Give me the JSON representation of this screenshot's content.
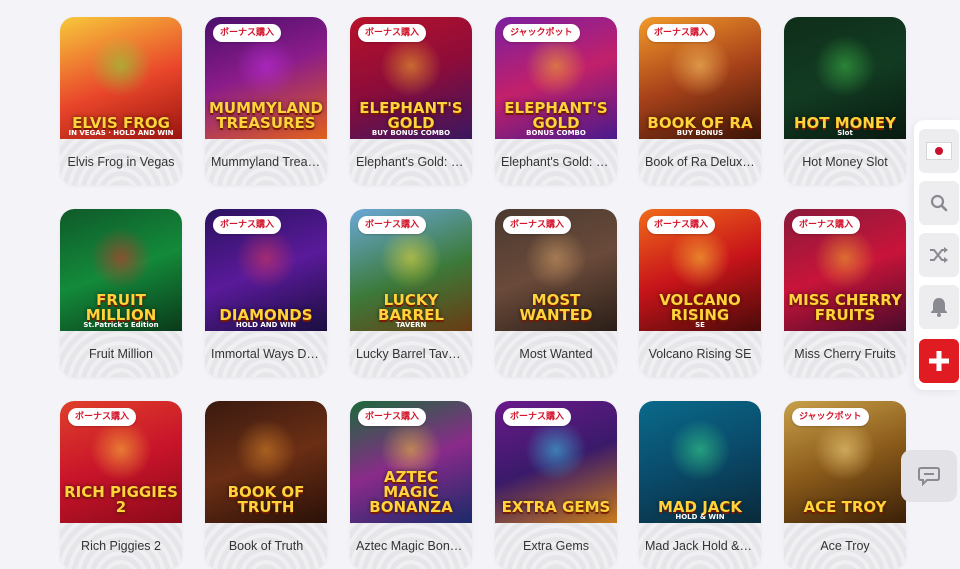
{
  "cards": [
    {
      "name": "Elvis Frog in Vegas",
      "badge": "",
      "art_title": "ELVIS FROG",
      "art_sub": "IN VEGAS · HOLD AND WIN",
      "bg": "linear-gradient(160deg,#f7c93b 0%,#e9462a 55%,#9b1410 100%)",
      "glow": "#7fe03a"
    },
    {
      "name": "Mummyland Treasures",
      "badge": "ボーナス購入",
      "art_title": "MUMMYLAND TREASURES",
      "art_sub": "",
      "bg": "linear-gradient(160deg,#4a0f6b 0%,#8b1c8a 45%,#e0611b 100%)",
      "glow": "#c030e0"
    },
    {
      "name": "Elephant's Gold: Buy Bonus Combo",
      "badge": "ボーナス購入",
      "art_title": "ELEPHANT'S GOLD",
      "art_sub": "BUY BONUS COMBO",
      "bg": "linear-gradient(160deg,#b8122a 0%,#8c0c3a 50%,#3a1760 100%)",
      "glow": "#f5b52a"
    },
    {
      "name": "Elephant's Gold: Bonus Combo",
      "badge": "ジャックポット",
      "art_title": "ELEPHANT'S GOLD",
      "art_sub": "BONUS COMBO",
      "bg": "linear-gradient(160deg,#7a1fa0 0%,#c2206a 50%,#4a1a8c 100%)",
      "glow": "#f5b52a"
    },
    {
      "name": "Book of Ra Deluxe Buy Bonus",
      "badge": "ボーナス購入",
      "art_title": "BOOK OF RA",
      "art_sub": "BUY BONUS",
      "bg": "linear-gradient(160deg,#f29a2a 0%,#a8421a 50%,#3b1408 100%)",
      "glow": "#ffd06a"
    },
    {
      "name": "Hot Money Slot",
      "badge": "",
      "art_title": "HOT MONEY",
      "art_sub": "Slot",
      "bg": "linear-gradient(160deg,#0f2e1a 0%,#123b22 50%,#081a10 100%)",
      "glow": "#3fbf4a"
    },
    {
      "name": "Fruit Million",
      "badge": "",
      "art_title": "FRUIT MILLION",
      "art_sub": "St.Patrick's Edition",
      "bg": "linear-gradient(160deg,#0f5a2a 0%,#138a3a 50%,#0a3a1a 100%)",
      "glow": "#e52a2a"
    },
    {
      "name": "Immortal Ways Diamonds",
      "badge": "ボーナス購入",
      "art_title": "DIAMONDS",
      "art_sub": "HOLD AND WIN",
      "bg": "linear-gradient(160deg,#2a1260 0%,#5a1a9a 50%,#1a0e40 100%)",
      "glow": "#e33a5a"
    },
    {
      "name": "Lucky Barrel Tavern",
      "badge": "ボーナス購入",
      "art_title": "LUCKY BARREL",
      "art_sub": "TAVERN",
      "bg": "linear-gradient(160deg,#6aa8d8 0%,#3c7a3a 55%,#6a3a12 100%)",
      "glow": "#f5e03a"
    },
    {
      "name": "Most Wanted",
      "badge": "ボーナス購入",
      "art_title": "MOST WANTED",
      "art_sub": "",
      "bg": "linear-gradient(160deg,#4a3a30 0%,#6a4a3a 50%,#2a1e18 100%)",
      "glow": "#d8a46a"
    },
    {
      "name": "Volcano Rising SE",
      "badge": "ボーナス購入",
      "art_title": "VOLCANO RISING",
      "art_sub": "SE",
      "bg": "linear-gradient(160deg,#f06a1a 0%,#c8141a 50%,#4a0a0a 100%)",
      "glow": "#ffd23a"
    },
    {
      "name": "Miss Cherry Fruits",
      "badge": "ボーナス購入",
      "art_title": "MISS CHERRY FRUITS",
      "art_sub": "",
      "bg": "linear-gradient(160deg,#8a1a3a 0%,#c8143a 50%,#4a0a2a 100%)",
      "glow": "#f5b52a"
    },
    {
      "name": "Rich Piggies 2",
      "badge": "ボーナス購入",
      "art_title": "RICH PIGGIES 2",
      "art_sub": "",
      "bg": "linear-gradient(160deg,#e0402a 0%,#c8142a 50%,#8a0a1a 100%)",
      "glow": "#ffc83a"
    },
    {
      "name": "Book of Truth",
      "badge": "",
      "art_title": "BOOK OF TRUTH",
      "art_sub": "",
      "bg": "linear-gradient(160deg,#3a1a10 0%,#6a2e14 50%,#2a1008 100%)",
      "glow": "#e08a2a"
    },
    {
      "name": "Aztec Magic Bonanza",
      "badge": "ボーナス購入",
      "art_title": "AZTEC MAGIC BONANZA",
      "art_sub": "",
      "bg": "linear-gradient(160deg,#1a6a3a 0%,#8a2a8a 50%,#1a2a6a 100%)",
      "glow": "#f5c83a"
    },
    {
      "name": "Extra Gems",
      "badge": "ボーナス購入",
      "art_title": "EXTRA GEMS",
      "art_sub": "",
      "bg": "linear-gradient(160deg,#6a1a8a 0%,#3a1a6a 50%,#c87a1a 100%)",
      "glow": "#3ad0f0"
    },
    {
      "name": "Mad Jack Hold & Win",
      "badge": "",
      "art_title": "MAD JACK",
      "art_sub": "HOLD & WIN",
      "bg": "linear-gradient(160deg,#0a6a8a 0%,#0a4a6a 50%,#0a2a3a 100%)",
      "glow": "#3ae08a"
    },
    {
      "name": "Ace Troy",
      "badge": "ジャックポット",
      "art_title": "ACE TROY",
      "art_sub": "",
      "bg": "linear-gradient(160deg,#c8a04a 0%,#8a5a1a 50%,#3a2008 100%)",
      "glow": "#ffe08a"
    }
  ],
  "sidebar": [
    {
      "name": "language-button",
      "icon": "japan-flag-icon"
    },
    {
      "name": "search-button",
      "icon": "search-icon"
    },
    {
      "name": "random-game-button",
      "icon": "shuffle-icon"
    },
    {
      "name": "notifications-button",
      "icon": "bell-icon"
    },
    {
      "name": "add-button",
      "icon": "plus-icon"
    }
  ],
  "chat": {
    "icon": "chat-icon"
  }
}
